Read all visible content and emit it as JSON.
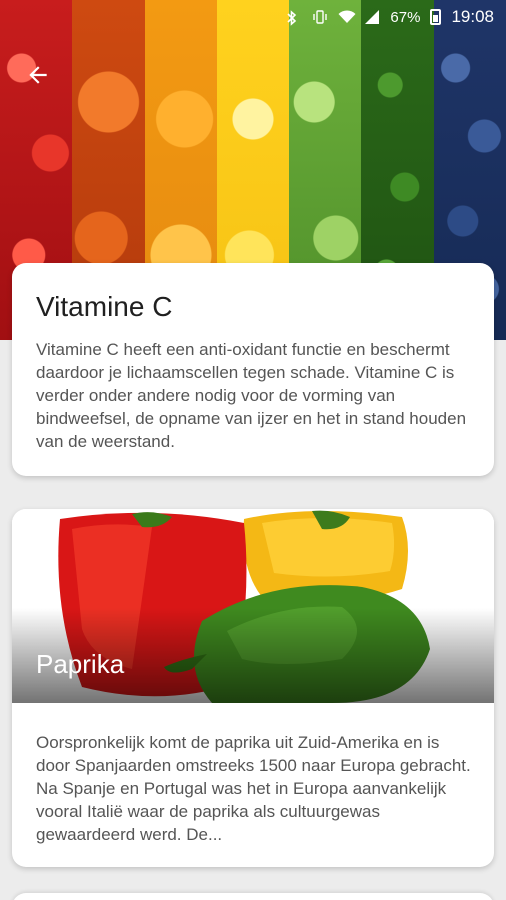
{
  "status_bar": {
    "battery_percent": "67%",
    "time": "19:08",
    "icons": [
      "bluetooth-icon",
      "vibrate-icon",
      "wifi-icon",
      "signal-icon",
      "battery-icon"
    ]
  },
  "header": {
    "back_icon": "arrow-back-icon"
  },
  "vitamin_card": {
    "title": "Vitamine C",
    "description": "Vitamine C heeft een  anti-oxidant functie en beschermt daardoor je lichaamscellen tegen schade. Vitamine C is verder onder andere nodig voor de vorming van bindweefsel, de opname van ijzer en het in stand houden van de weerstand."
  },
  "food_cards": [
    {
      "title": "Paprika",
      "description": "Oorspronkelijk komt de paprika uit Zuid-Amerika en is door Spanjaarden omstreeks 1500 naar Europa gebracht. Na Spanje en Portugal was het in Europa aanvankelijk vooral Italië waar de paprika als cultuurgewas gewaardeerd werd. De..."
    }
  ],
  "colors": {
    "background": "#ececec",
    "card": "#ffffff",
    "title_text": "#202020",
    "body_text": "#555555"
  }
}
